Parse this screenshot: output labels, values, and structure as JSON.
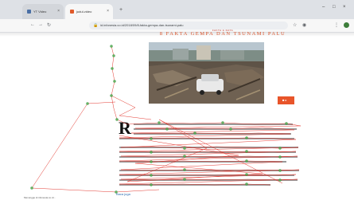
{
  "browser": {
    "tabs": [
      {
        "label": "YT Video",
        "active": false,
        "favicon_color": "#4a6fa5"
      },
      {
        "label": "judul-video",
        "active": true,
        "favicon_color": "#e05a2a"
      }
    ],
    "url": "id.infonesia.co.id/2018/09/8-fakta-gempa-dan-tsunami-palu",
    "icons": [
      "back-icon",
      "forward-icon",
      "reload-icon",
      "lock-icon",
      "star-icon",
      "menu-icon"
    ]
  },
  "article": {
    "kicker": "FAKTA & DATA",
    "title": "8 FAKTA GEMPA DAN TSUNAMI PALU",
    "dropcap": "R",
    "share_label": "■ ▸",
    "read_more": "Baca juga"
  },
  "status": {
    "text": "Menunggu id.infonesia.co.id..."
  },
  "colors": {
    "accent": "#e8552a",
    "title": "#d9542c",
    "gaze_line": "#e0241b",
    "gaze_point": "#4caf50"
  }
}
